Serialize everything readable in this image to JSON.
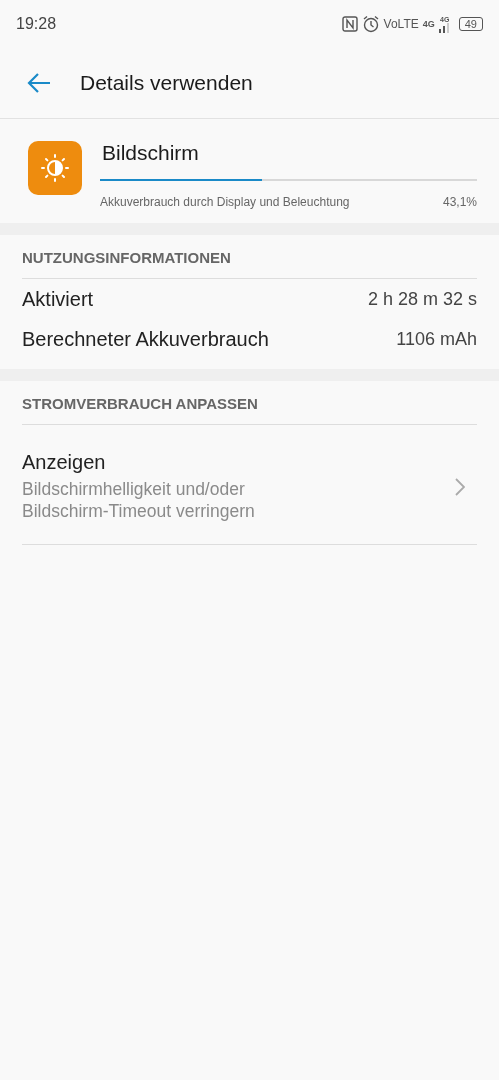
{
  "status_bar": {
    "time": "19:28",
    "network": "VoLTE",
    "data_type": "4G",
    "signal_type": "4G",
    "battery": "49"
  },
  "header": {
    "title": "Details verwenden"
  },
  "app": {
    "name": "Bildschirm",
    "level": 0.431,
    "description": "Akkuverbrauch durch Display und Beleuchtung",
    "percent": "43,1%"
  },
  "usage": {
    "title": "NUTZUNGSINFORMATIONEN",
    "rows": [
      {
        "label": "Aktiviert",
        "value": "2 h 28 m 32 s"
      },
      {
        "label": "Berechneter Akkuverbrauch",
        "value": "1106 mAh"
      }
    ]
  },
  "adjust": {
    "title": "STROMVERBRAUCH ANPASSEN",
    "items": [
      {
        "title": "Anzeigen",
        "lines": [
          "Bildschirmhelligkeit und/oder",
          "Bildschirm-Timeout verringern"
        ]
      }
    ]
  }
}
